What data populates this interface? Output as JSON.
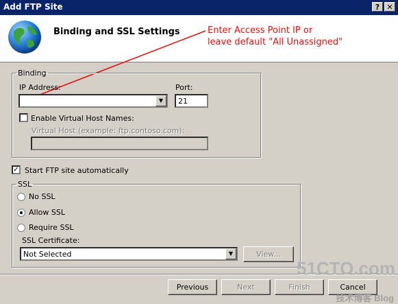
{
  "window": {
    "title": "Add FTP Site",
    "help_label": "?",
    "close_label": "✕"
  },
  "header": {
    "title": "Binding and SSL Settings"
  },
  "annotation": {
    "text": "Enter Access Point IP or\nleave default \"All Unassigned\""
  },
  "binding": {
    "legend": "Binding",
    "ip_label": "IP Address:",
    "ip_value": "",
    "port_label": "Port:",
    "port_value": "21",
    "vhost_checkbox_label": "Enable Virtual Host Names:",
    "vhost_checked": false,
    "vhost_label": "Virtual Host (example: ftp.contoso.com):",
    "vhost_value": ""
  },
  "start_auto": {
    "label": "Start FTP site automatically",
    "checked": true
  },
  "ssl": {
    "legend": "SSL",
    "options": [
      "No SSL",
      "Allow SSL",
      "Require SSL"
    ],
    "selected": "Allow SSL",
    "cert_label": "SSL Certificate:",
    "cert_value": "Not Selected",
    "view_label": "View..."
  },
  "footer": {
    "previous": "Previous",
    "next": "Next",
    "finish": "Finish",
    "cancel": "Cancel"
  },
  "watermark": {
    "main": "51CTO.com",
    "sub": "技术博客 Blog"
  },
  "icons": {
    "globe": "globe-icon",
    "dropdown": "chevron-down-icon"
  }
}
